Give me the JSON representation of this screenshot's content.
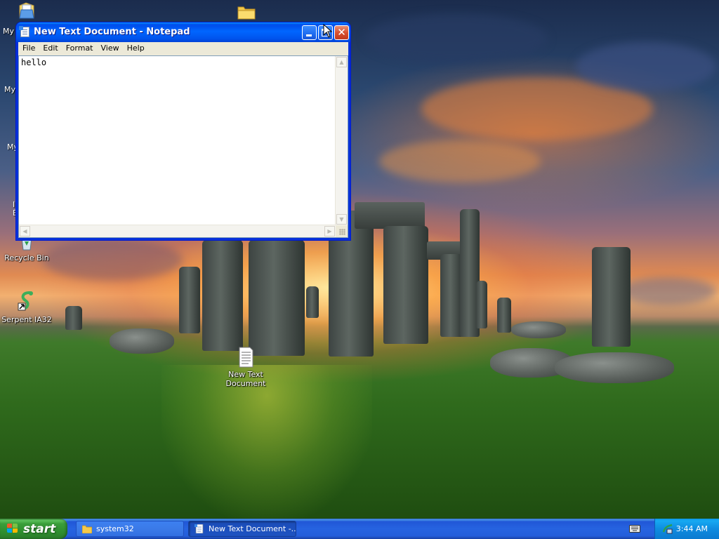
{
  "desktop": {
    "icons": [
      {
        "label": "Recycle Bin",
        "icon": "recycle-bin-icon"
      },
      {
        "label": "Serpent IA32",
        "icon": "serpent-icon"
      },
      {
        "label": "New Text Document",
        "icon": "text-document-icon"
      }
    ],
    "partial_labels": [
      "My",
      "My",
      "My",
      "I",
      "E"
    ]
  },
  "notepad": {
    "title": "New Text Document - Notepad",
    "menu": [
      "File",
      "Edit",
      "Format",
      "View",
      "Help"
    ],
    "content": "hello"
  },
  "taskbar": {
    "start_label": "start",
    "buttons": [
      {
        "label": "system32",
        "icon": "folder-icon",
        "active": false
      },
      {
        "label": "New Text Document -...",
        "icon": "notepad-icon",
        "active": true
      }
    ],
    "clock": "3:44 AM"
  },
  "colors": {
    "taskbar_blue": "#245edb",
    "start_green": "#3a9e3a",
    "title_blue": "#0058ee",
    "close_red": "#d8502f"
  }
}
